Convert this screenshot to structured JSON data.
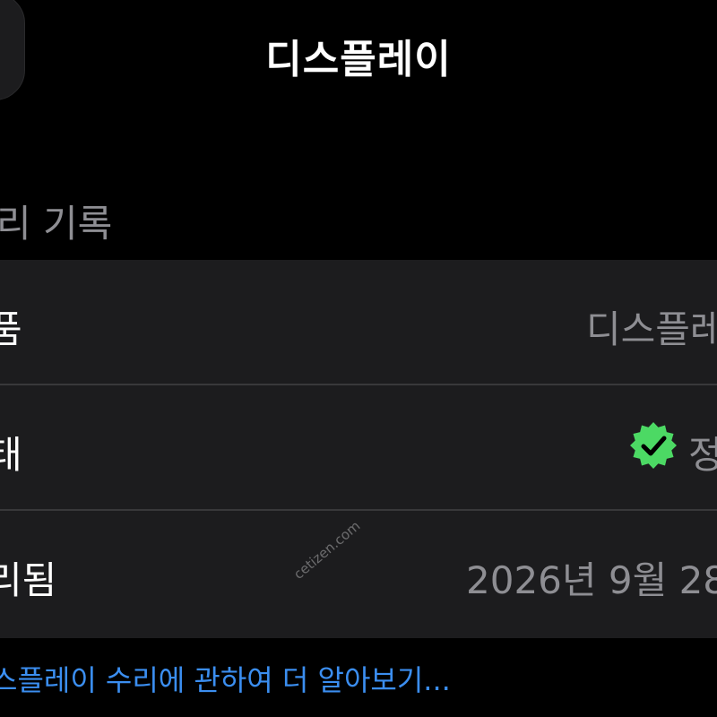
{
  "header": {
    "title": "디스플레이"
  },
  "section": {
    "title": "리 기록"
  },
  "rows": [
    {
      "label": "품",
      "value": "디스플레"
    },
    {
      "label": "태",
      "value": "정",
      "icon": "verified-check-icon",
      "icon_color": "#4cd964"
    },
    {
      "label": "리됨",
      "value": "2026년 9월 28"
    }
  ],
  "watermark": "cetizen.com",
  "footer": {
    "link": "스플레이 수리에 관하여 더 알아보기..."
  },
  "colors": {
    "background": "#000000",
    "group_background": "#1c1c1e",
    "secondary_text": "#8e8e93",
    "link": "#3b8ef0",
    "check": "#4cd964"
  }
}
